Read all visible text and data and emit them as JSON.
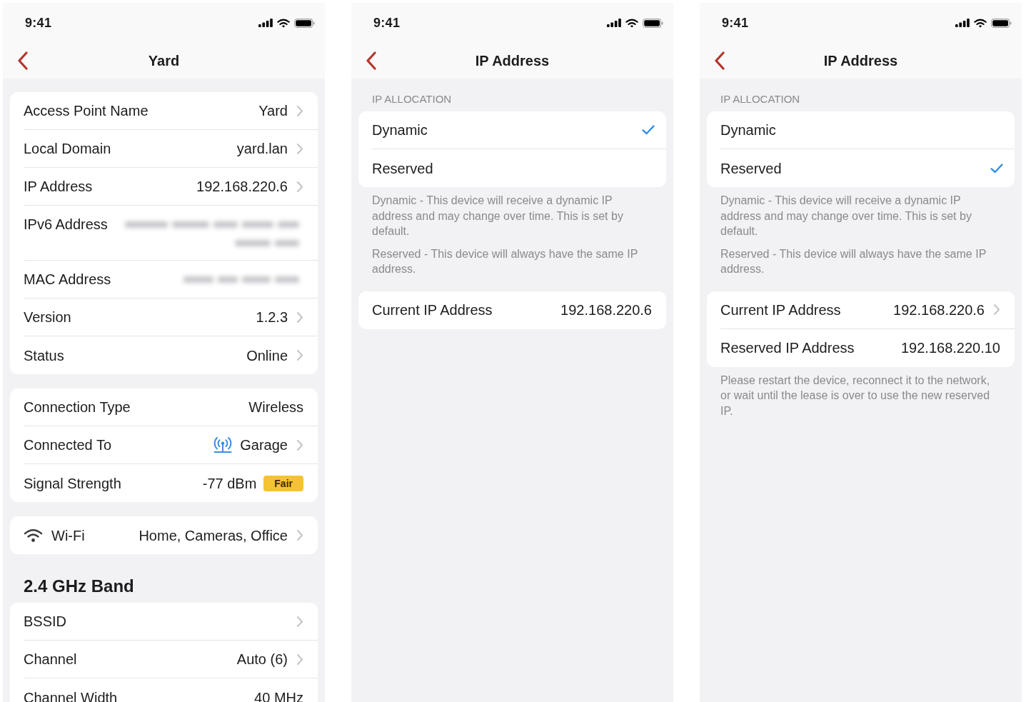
{
  "screens": [
    {
      "status_bar": {
        "time": "9:41"
      },
      "nav": {
        "title": "Yard"
      },
      "groups": [
        {
          "rows": [
            {
              "kind": "value",
              "label": "Access Point Name",
              "value": "Yard",
              "chevron": true
            },
            {
              "kind": "value",
              "label": "Local Domain",
              "value": "yard.lan",
              "chevron": true
            },
            {
              "kind": "value",
              "label": "IP Address",
              "value": "192.168.220.6",
              "chevron": true
            },
            {
              "kind": "masked-long",
              "label": "IPv6 Address"
            },
            {
              "kind": "masked",
              "label": "MAC Address"
            },
            {
              "kind": "value",
              "label": "Version",
              "value": "1.2.3",
              "chevron": true
            },
            {
              "kind": "value",
              "label": "Status",
              "value": "Online",
              "chevron": true
            }
          ]
        },
        {
          "rows": [
            {
              "kind": "value",
              "label": "Connection Type",
              "value": "Wireless",
              "chevron": false
            },
            {
              "kind": "device",
              "label": "Connected To",
              "value": "Garage",
              "chevron": true
            },
            {
              "kind": "signal",
              "label": "Signal Strength",
              "value": "-77 dBm",
              "badge": "Fair",
              "color": "#f5c233"
            }
          ]
        },
        {
          "rows": [
            {
              "kind": "wifi",
              "label": "Wi-Fi",
              "value": "Home, Cameras, Office",
              "chevron": true
            }
          ]
        },
        {
          "header": {
            "kind": "title",
            "text": "2.4 GHz Band"
          },
          "rows": [
            {
              "kind": "value",
              "label": "BSSID",
              "chevron": true
            },
            {
              "kind": "value",
              "label": "Channel",
              "value": "Auto (6)",
              "chevron": true
            },
            {
              "kind": "value",
              "label": "Channel Width",
              "value": "40 MHz",
              "chevron": false
            }
          ]
        }
      ]
    },
    {
      "status_bar": {
        "time": "9:41"
      },
      "nav": {
        "title": "IP Address"
      },
      "groups": [
        {
          "header": {
            "kind": "caption",
            "text": "IP ALLOCATION"
          },
          "rows": [
            {
              "kind": "option",
              "label": "Dynamic",
              "selected": true
            },
            {
              "kind": "option",
              "label": "Reserved",
              "selected": false
            }
          ],
          "footer": [
            "Dynamic - This device will receive a dynamic IP address and may change over time. This is set by default.",
            "Reserved - This device will always have the same IP address."
          ]
        },
        {
          "rows": [
            {
              "kind": "value",
              "label": "Current IP Address",
              "value": "192.168.220.6",
              "chevron": false
            }
          ]
        }
      ]
    },
    {
      "status_bar": {
        "time": "9:41"
      },
      "nav": {
        "title": "IP Address"
      },
      "groups": [
        {
          "header": {
            "kind": "caption",
            "text": "IP ALLOCATION"
          },
          "rows": [
            {
              "kind": "option",
              "label": "Dynamic",
              "selected": false
            },
            {
              "kind": "option",
              "label": "Reserved",
              "selected": true
            }
          ],
          "footer": [
            "Dynamic - This device will receive a dynamic IP address and may change over time. This is set by default.",
            "Reserved - This device will always have the same IP address."
          ]
        },
        {
          "rows": [
            {
              "kind": "value",
              "label": "Current IP Address",
              "value": "192.168.220.6",
              "chevron": true
            },
            {
              "kind": "value",
              "label": "Reserved IP Address",
              "value": "192.168.220.10",
              "chevron": false
            }
          ],
          "footer": [
            "Please restart the device, reconnect it to the network, or wait until the lease is over to use the new reserved IP."
          ]
        }
      ]
    }
  ]
}
